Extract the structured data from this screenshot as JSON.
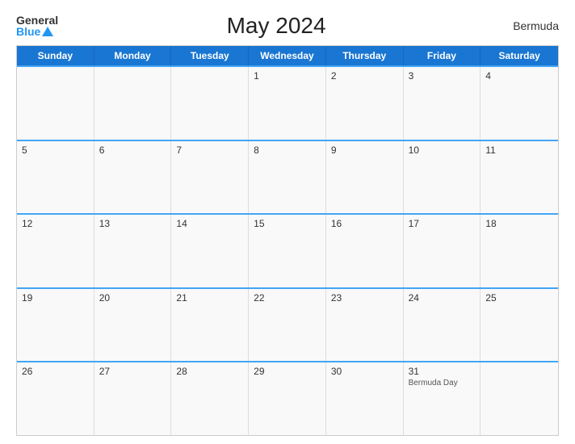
{
  "logo": {
    "general": "General",
    "blue": "Blue"
  },
  "title": "May 2024",
  "region": "Bermuda",
  "days_header": [
    "Sunday",
    "Monday",
    "Tuesday",
    "Wednesday",
    "Thursday",
    "Friday",
    "Saturday"
  ],
  "weeks": [
    [
      {
        "day": "",
        "holiday": ""
      },
      {
        "day": "",
        "holiday": ""
      },
      {
        "day": "",
        "holiday": ""
      },
      {
        "day": "1",
        "holiday": ""
      },
      {
        "day": "2",
        "holiday": ""
      },
      {
        "day": "3",
        "holiday": ""
      },
      {
        "day": "4",
        "holiday": ""
      }
    ],
    [
      {
        "day": "5",
        "holiday": ""
      },
      {
        "day": "6",
        "holiday": ""
      },
      {
        "day": "7",
        "holiday": ""
      },
      {
        "day": "8",
        "holiday": ""
      },
      {
        "day": "9",
        "holiday": ""
      },
      {
        "day": "10",
        "holiday": ""
      },
      {
        "day": "11",
        "holiday": ""
      }
    ],
    [
      {
        "day": "12",
        "holiday": ""
      },
      {
        "day": "13",
        "holiday": ""
      },
      {
        "day": "14",
        "holiday": ""
      },
      {
        "day": "15",
        "holiday": ""
      },
      {
        "day": "16",
        "holiday": ""
      },
      {
        "day": "17",
        "holiday": ""
      },
      {
        "day": "18",
        "holiday": ""
      }
    ],
    [
      {
        "day": "19",
        "holiday": ""
      },
      {
        "day": "20",
        "holiday": ""
      },
      {
        "day": "21",
        "holiday": ""
      },
      {
        "day": "22",
        "holiday": ""
      },
      {
        "day": "23",
        "holiday": ""
      },
      {
        "day": "24",
        "holiday": ""
      },
      {
        "day": "25",
        "holiday": ""
      }
    ],
    [
      {
        "day": "26",
        "holiday": ""
      },
      {
        "day": "27",
        "holiday": ""
      },
      {
        "day": "28",
        "holiday": ""
      },
      {
        "day": "29",
        "holiday": ""
      },
      {
        "day": "30",
        "holiday": ""
      },
      {
        "day": "31",
        "holiday": "Bermuda Day"
      },
      {
        "day": "",
        "holiday": ""
      }
    ]
  ]
}
